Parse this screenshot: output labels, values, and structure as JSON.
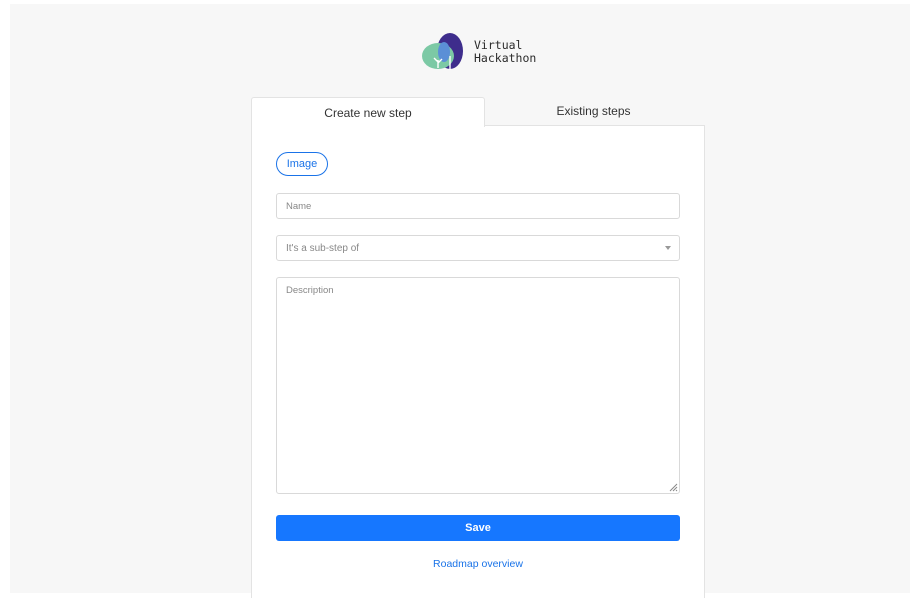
{
  "brand": {
    "line1": "Virtual",
    "line2": "Hackathon",
    "colors": {
      "leaf_green": "#7cc9a5",
      "leaf_blue": "#5b8fd6",
      "leaf_purple": "#3e2d8c"
    }
  },
  "tabs": [
    {
      "label": "Create new step",
      "active": true
    },
    {
      "label": "Existing steps",
      "active": false
    }
  ],
  "form": {
    "image_button": "Image",
    "name_placeholder": "Name",
    "name_value": "",
    "parent_select_placeholder": "It's a sub-step of",
    "description_placeholder": "Description",
    "description_value": "",
    "save_label": "Save",
    "roadmap_link": "Roadmap overview"
  },
  "colors": {
    "accent": "#1677ff",
    "link": "#1a73e8",
    "background": "#f7f7f7"
  }
}
